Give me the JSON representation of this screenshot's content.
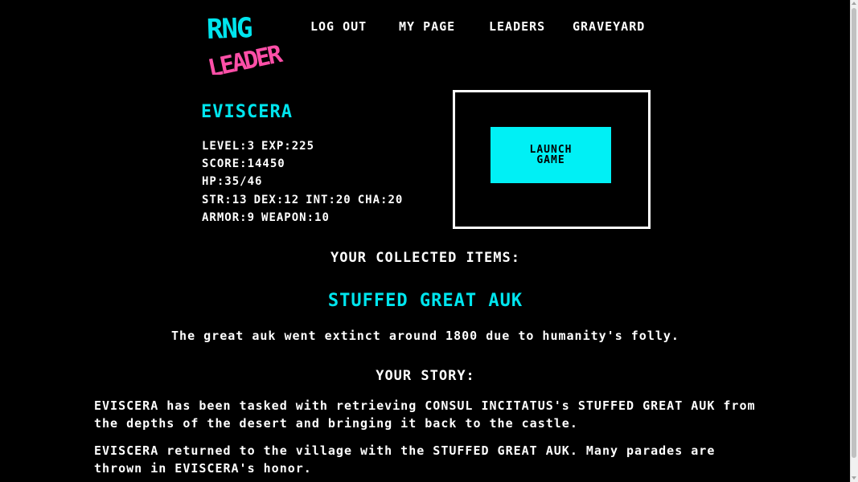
{
  "logo": {
    "line1": "RNG",
    "line2": "LEADER",
    "color1": "#00e5ee",
    "color2": "#ff4fa8"
  },
  "nav": {
    "items": [
      {
        "label": "LOG OUT"
      },
      {
        "label": "MY PAGE"
      },
      {
        "label": "LEADERS"
      },
      {
        "label": "GRAVEYARD"
      }
    ]
  },
  "character": {
    "name": "EVISCERA",
    "level_label": "LEVEL:3",
    "exp_label": "EXP:225",
    "score_label": "SCORE:14450",
    "hp_label": "HP:35/46",
    "str_label": "STR:13",
    "dex_label": "DEX:12",
    "int_label": "INT:20",
    "cha_label": "CHA:20",
    "armor_label": "ARMOR:9",
    "weapon_label": "WEAPON:10"
  },
  "launch": {
    "line1": "LAUNCH",
    "line2": "GAME"
  },
  "items": {
    "heading": "YOUR COLLECTED ITEMS:",
    "name": "STUFFED GREAT AUK",
    "description": "The great auk went extinct around 1800 due to humanity's folly."
  },
  "story": {
    "heading": "YOUR STORY:",
    "paragraphs": [
      "EVISCERA has been tasked with retrieving CONSUL INCITATUS's STUFFED GREAT AUK from the depths of the desert and bringing it back to the castle.",
      "EVISCERA returned to the village with the STUFFED GREAT AUK. Many parades are thrown in EVISCERA's honor."
    ]
  },
  "colors": {
    "accent": "#00e5ee",
    "background": "#000000",
    "text": "#ffffff",
    "logo_pink": "#ff4fa8"
  }
}
